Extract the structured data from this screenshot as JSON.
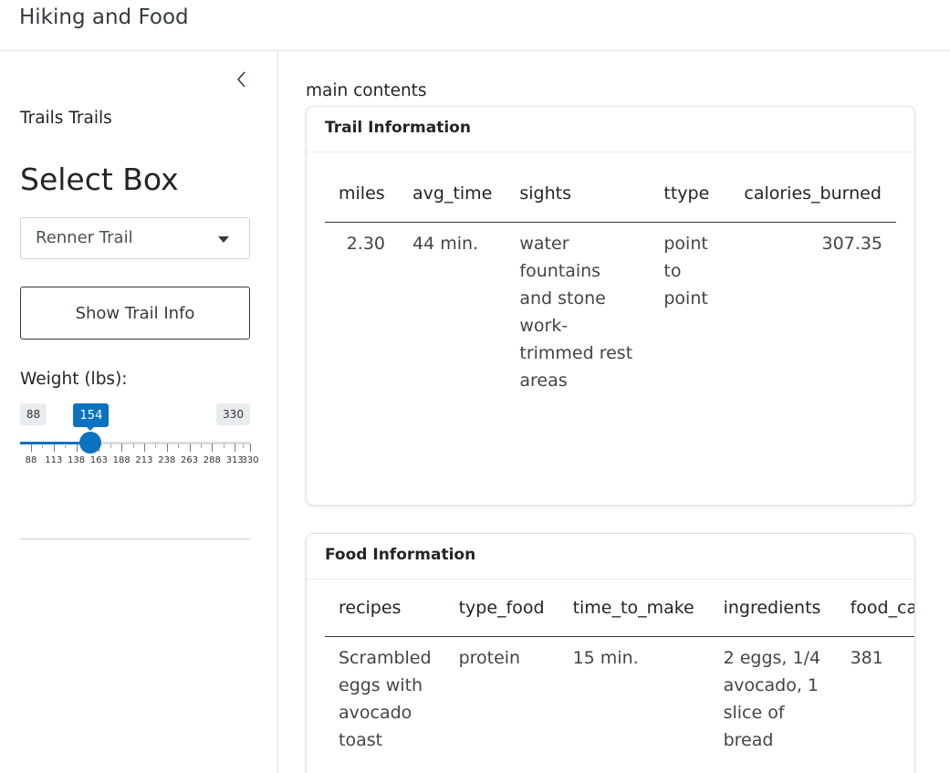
{
  "app": {
    "title": "Hiking and Food"
  },
  "sidebar": {
    "collapse_icon": "chevron-left-icon",
    "title": "Trails Trails",
    "select_heading": "Select Box",
    "select": {
      "selected": "Renner Trail"
    },
    "show_button_label": "Show Trail Info",
    "weight": {
      "label": "Weight (lbs):",
      "min": "88",
      "max": "330",
      "value": "154",
      "tick_labels": [
        "88",
        "113",
        "138",
        "163",
        "188",
        "213",
        "238",
        "263",
        "288",
        "313",
        "330"
      ]
    }
  },
  "main": {
    "label": "main contents",
    "trail_card": {
      "title": "Trail Information",
      "columns": [
        "miles",
        "avg_time",
        "sights",
        "ttype",
        "calories_burned"
      ],
      "row": {
        "miles": "2.30",
        "avg_time": "44 min.",
        "sights": "water fountains and stone work-trimmed rest areas",
        "ttype": "point to point",
        "calories_burned": "307.35"
      }
    },
    "food_card": {
      "title": "Food Information",
      "columns": [
        "recipes",
        "type_food",
        "time_to_make",
        "ingredients",
        "food_ca"
      ],
      "row": {
        "recipes": "Scrambled eggs with avocado toast",
        "type_food": "protein",
        "time_to_make": "15 min.",
        "ingredients": "2 eggs, 1/4 avocado, 1 slice of bread",
        "food_cal": "381"
      }
    }
  }
}
